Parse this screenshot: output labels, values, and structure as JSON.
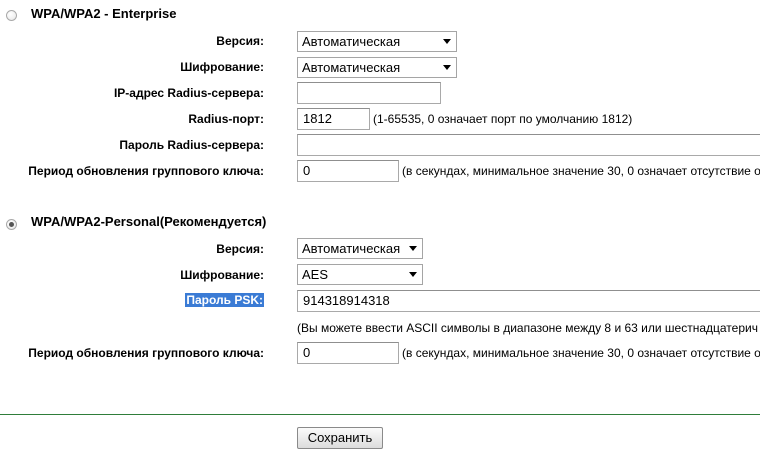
{
  "enterprise": {
    "title": "WPA/WPA2 - Enterprise",
    "selected": false,
    "version_label": "Версия:",
    "version_value": "Автоматическая",
    "encryption_label": "Шифрование:",
    "encryption_value": "Автоматическая",
    "radius_ip_label": "IP-адрес Radius-сервера:",
    "radius_ip_value": "",
    "radius_port_label": "Radius-порт:",
    "radius_port_value": "1812",
    "radius_port_hint": "(1-65535, 0 означает порт по умолчанию 1812)",
    "radius_password_label": "Пароль Radius-сервера:",
    "radius_password_value": "",
    "group_key_label": "Период обновления группового ключа:",
    "group_key_value": "0",
    "group_key_hint": "(в секундах, минимальное значение 30, 0 означает отсутствие о"
  },
  "personal": {
    "title": "WPA/WPA2-Personal(Рекомендуется)",
    "selected": true,
    "version_label": "Версия:",
    "version_value": "Автоматическая",
    "encryption_label": "Шифрование:",
    "encryption_value": "AES",
    "psk_label": "Пароль PSK:",
    "psk_value": "914318914318",
    "psk_hint": "(Вы можете ввести ASCII символы в диапазоне между 8 и 63 или шестнадцатерич",
    "group_key_label": "Период обновления группового ключа:",
    "group_key_value": "0",
    "group_key_hint": "(в секундах, минимальное значение 30, 0 означает отсутствие о"
  },
  "footer": {
    "save_label": "Сохранить"
  },
  "colors": {
    "highlight": "#3a7bd5",
    "divider": "#2f7d3a"
  },
  "icons": {
    "dropdown": "chevron-down-icon"
  }
}
